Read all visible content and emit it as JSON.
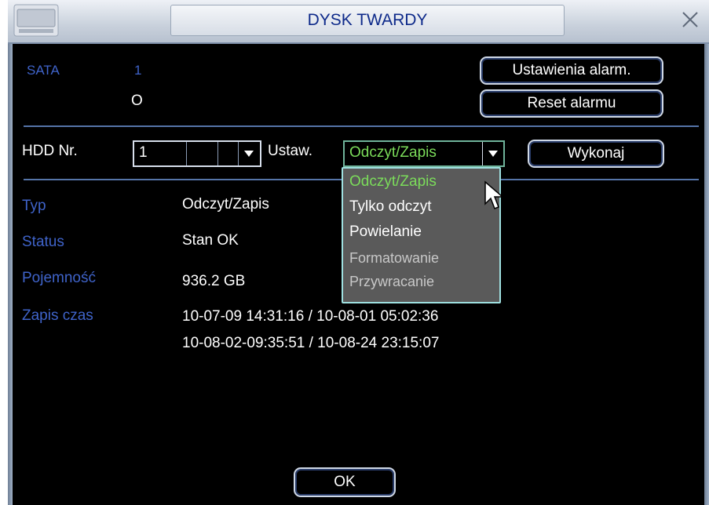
{
  "window": {
    "title": "DYSK TWARDY"
  },
  "sata": {
    "label": "SATA",
    "number": "1",
    "status_symbol": "O"
  },
  "buttons": {
    "alarm_settings": "Ustawienia alarm.",
    "alarm_reset": "Reset alarmu",
    "execute": "Wykonaj",
    "ok": "OK"
  },
  "hdd": {
    "label": "HDD Nr.",
    "value": "1"
  },
  "set": {
    "label": "Ustaw.",
    "value": "Odczyt/Zapis"
  },
  "dropdown": {
    "options": [
      "Odczyt/Zapis",
      "Tylko odczyt",
      "Powielanie",
      "Formatowanie",
      "Przywracanie"
    ],
    "selected": "Odczyt/Zapis"
  },
  "info": {
    "type_label": "Typ",
    "type_value": "Odczyt/Zapis",
    "status_label": "Status",
    "status_value": "Stan OK",
    "capacity_label": "Pojemność",
    "capacity_value": "936.2 GB",
    "record_label": "Zapis czas",
    "record_line1": "10-07-09 14:31:16  /  10-08-01 05:02:36",
    "record_line2": "10-08-02-09:35:51  /  10-08-24 23:15:07"
  },
  "colors": {
    "label_blue": "#3f63c9",
    "selected_green": "#7bdc5a",
    "title_blue": "#0e2a8a"
  }
}
